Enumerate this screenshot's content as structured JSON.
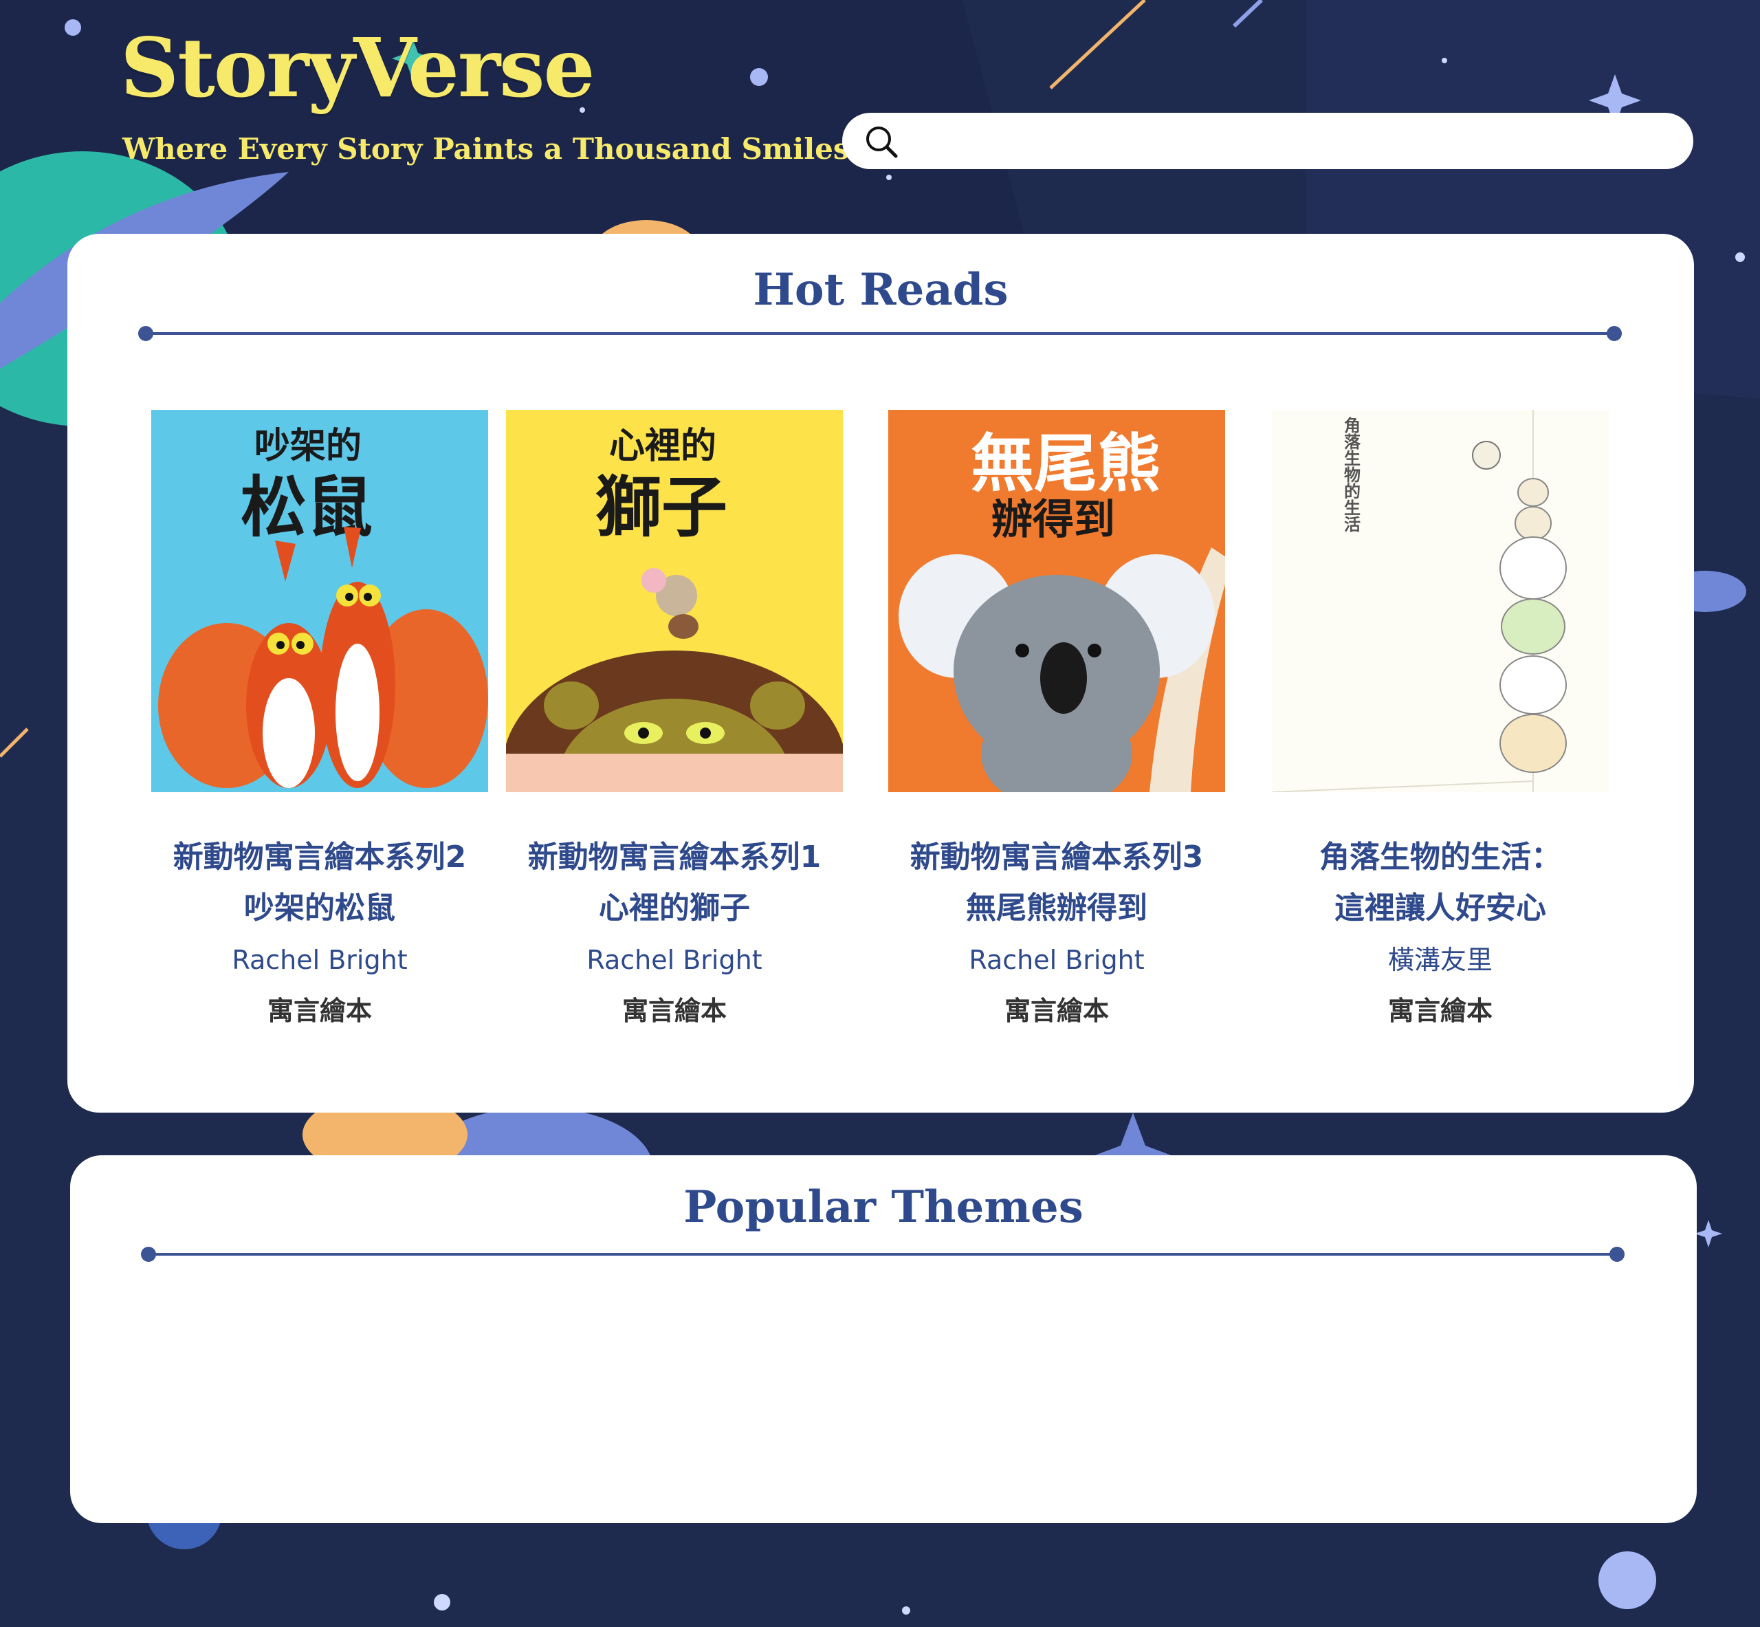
{
  "brand": {
    "name": "StoryVerse",
    "tagline": "Where Every Story Paints a Thousand Smiles"
  },
  "search": {
    "placeholder": "",
    "value": ""
  },
  "hot_reads": {
    "title": "Hot Reads",
    "books": [
      {
        "title_line1": "新動物寓言繪本系列2",
        "title_line2": "吵架的松鼠",
        "author": "Rachel Bright",
        "genre": "寓言繪本",
        "cover_title_line1": "吵架的",
        "cover_title_line2": "松鼠",
        "cover_color": "#5ec8e8",
        "cover_icon": "squirrels-illustration"
      },
      {
        "title_line1": "新動物寓言繪本系列1",
        "title_line2": "心裡的獅子",
        "author": "Rachel Bright",
        "genre": "寓言繪本",
        "cover_title_line1": "心裡的",
        "cover_title_line2": "獅子",
        "cover_color": "#fde24a",
        "cover_icon": "lion-and-mouse-illustration"
      },
      {
        "title_line1": "新動物寓言繪本系列3",
        "title_line2": "無尾熊辦得到",
        "author": "Rachel Bright",
        "genre": "寓言繪本",
        "cover_title_line1": "無尾熊",
        "cover_title_line2": "辦得到",
        "cover_color": "#f07a2e",
        "cover_icon": "koala-illustration"
      },
      {
        "title_line1": "角落生物的生活：",
        "title_line2": "這裡讓人好安心",
        "author": "橫溝友里",
        "genre": "寓言繪本",
        "cover_title_line1": "角落生物的生活",
        "cover_title_line2": "",
        "cover_color": "#fdfcf5",
        "cover_icon": "sumikko-stack-illustration"
      }
    ]
  },
  "popular_themes": {
    "title": "Popular Themes"
  },
  "colors": {
    "background": "#1f2a4f",
    "brand_yellow": "#f7ea6b",
    "heading_blue": "#2f4a8c",
    "panel": "#ffffff"
  }
}
